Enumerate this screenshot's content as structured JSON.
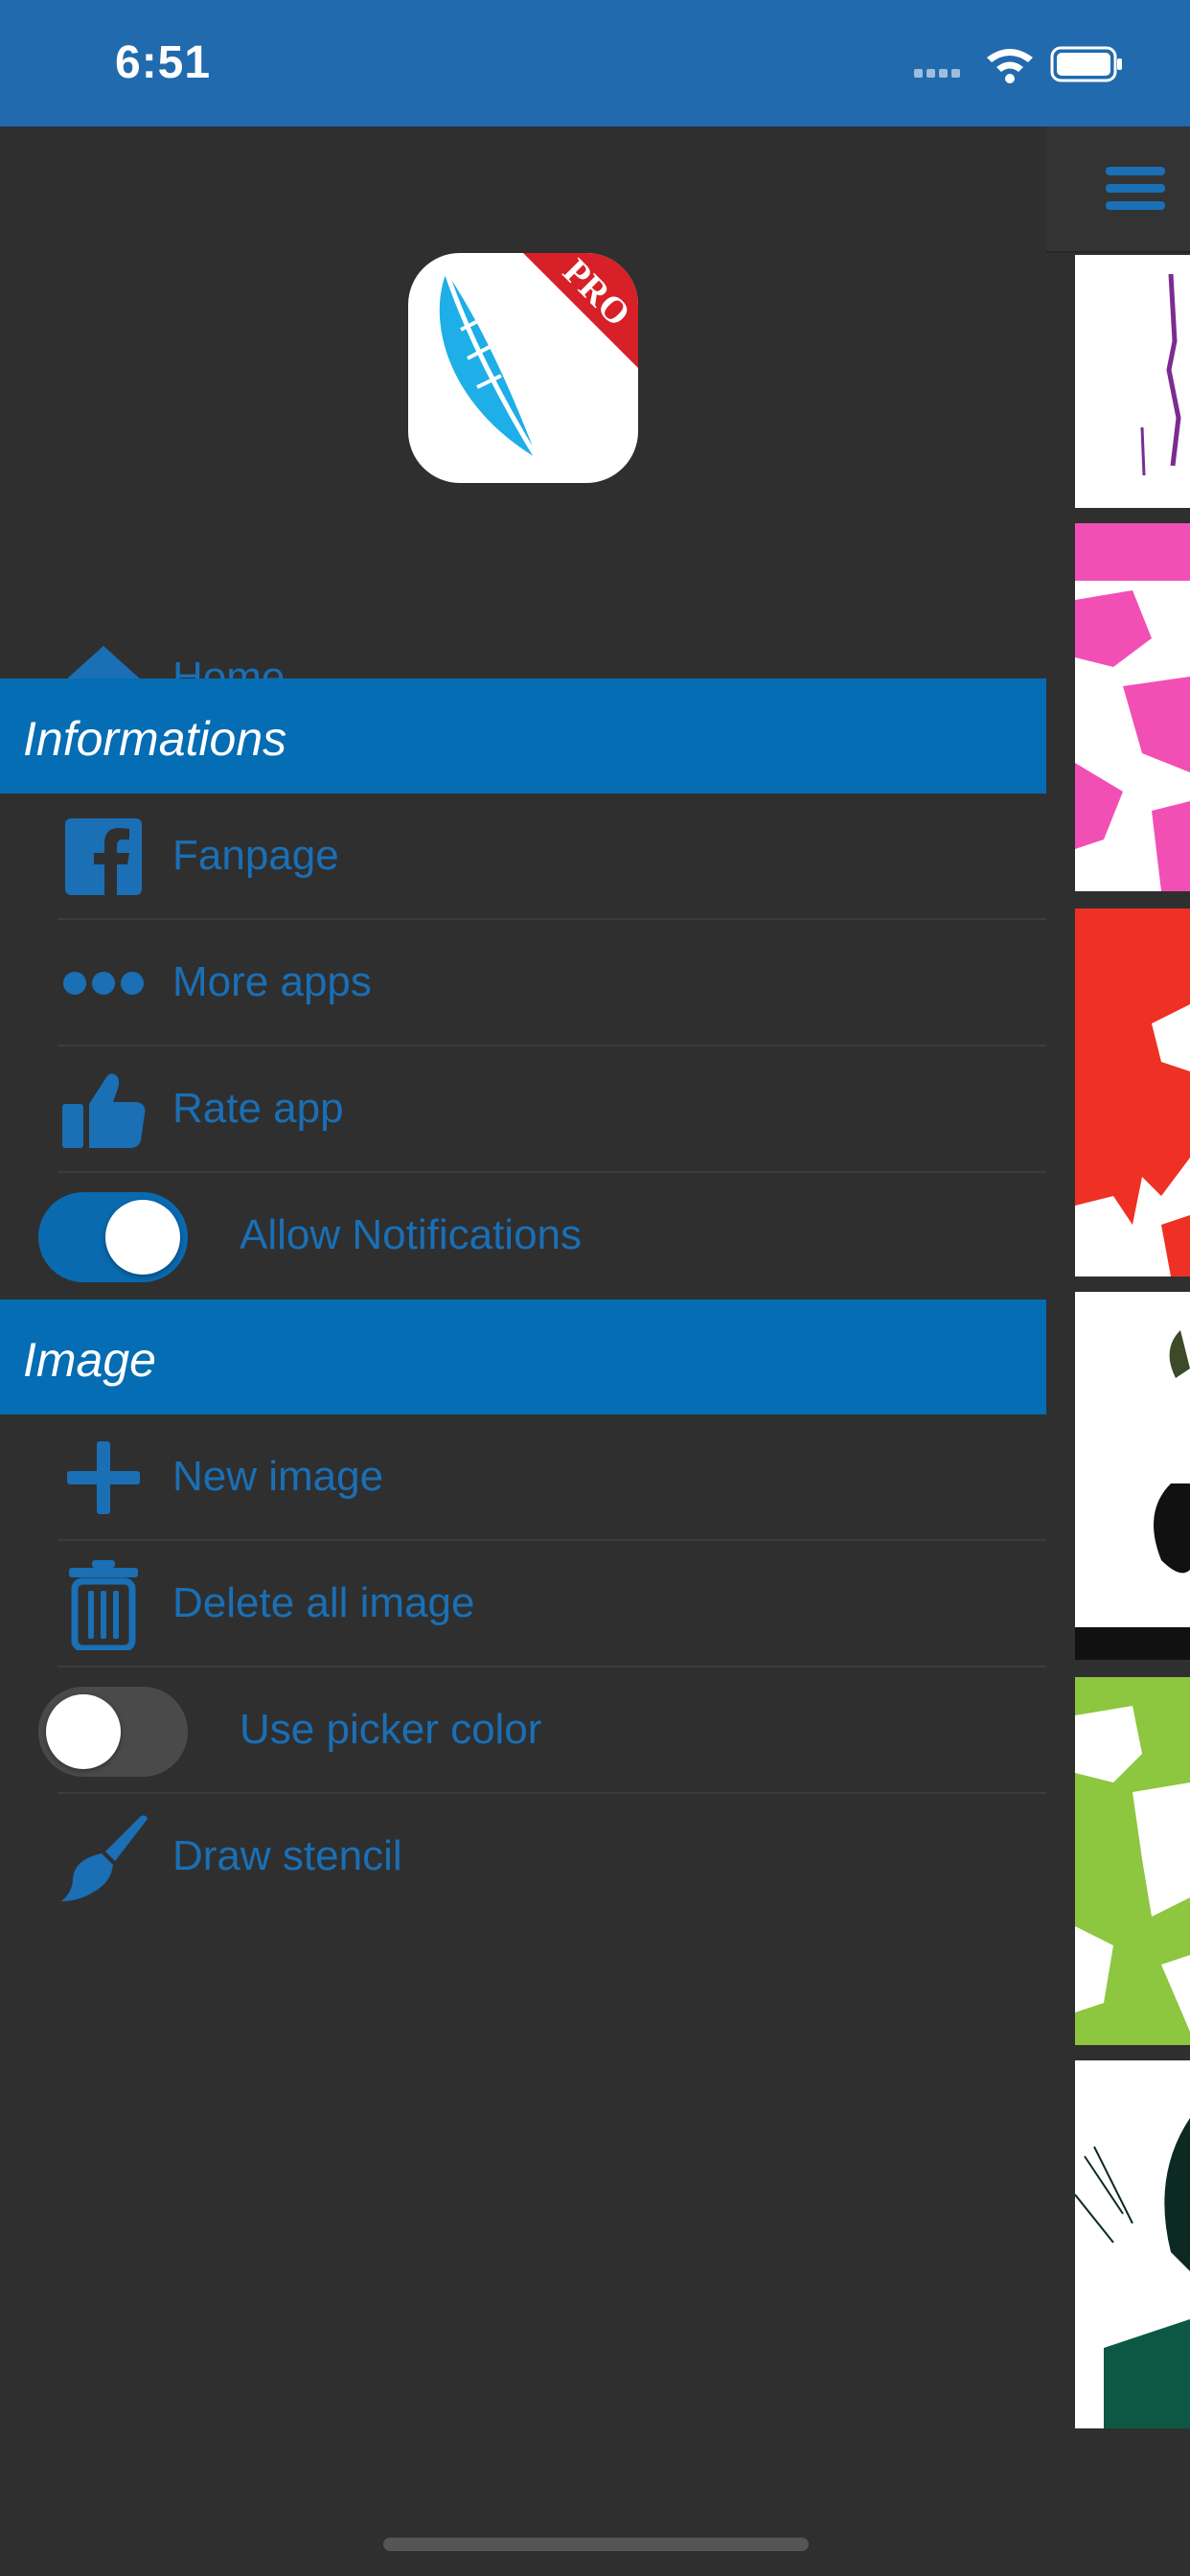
{
  "status_bar": {
    "time": "6:51",
    "background": "#216aad"
  },
  "menu": {
    "home": {
      "label": "Home",
      "icon": "home-icon"
    },
    "sections": [
      {
        "title": "Informations",
        "items": [
          {
            "label": "Fanpage",
            "icon": "facebook-icon"
          },
          {
            "label": "More apps",
            "icon": "more-dots-icon"
          },
          {
            "label": "Rate app",
            "icon": "thumbs-up-icon"
          },
          {
            "label": "Allow Notifications",
            "type": "toggle",
            "on": true
          }
        ]
      },
      {
        "title": "Image",
        "items": [
          {
            "label": "New image",
            "icon": "plus-icon"
          },
          {
            "label": "Delete all image",
            "icon": "trash-icon"
          },
          {
            "label": "Use picker color",
            "type": "toggle",
            "on": false
          },
          {
            "label": "Draw stencil",
            "icon": "brush-icon"
          }
        ]
      }
    ]
  },
  "app_icon": {
    "badge_text": "PRO"
  },
  "colors": {
    "accent": "#1a6fb5",
    "section_header": "#046db3",
    "background": "#2f2f2f"
  }
}
